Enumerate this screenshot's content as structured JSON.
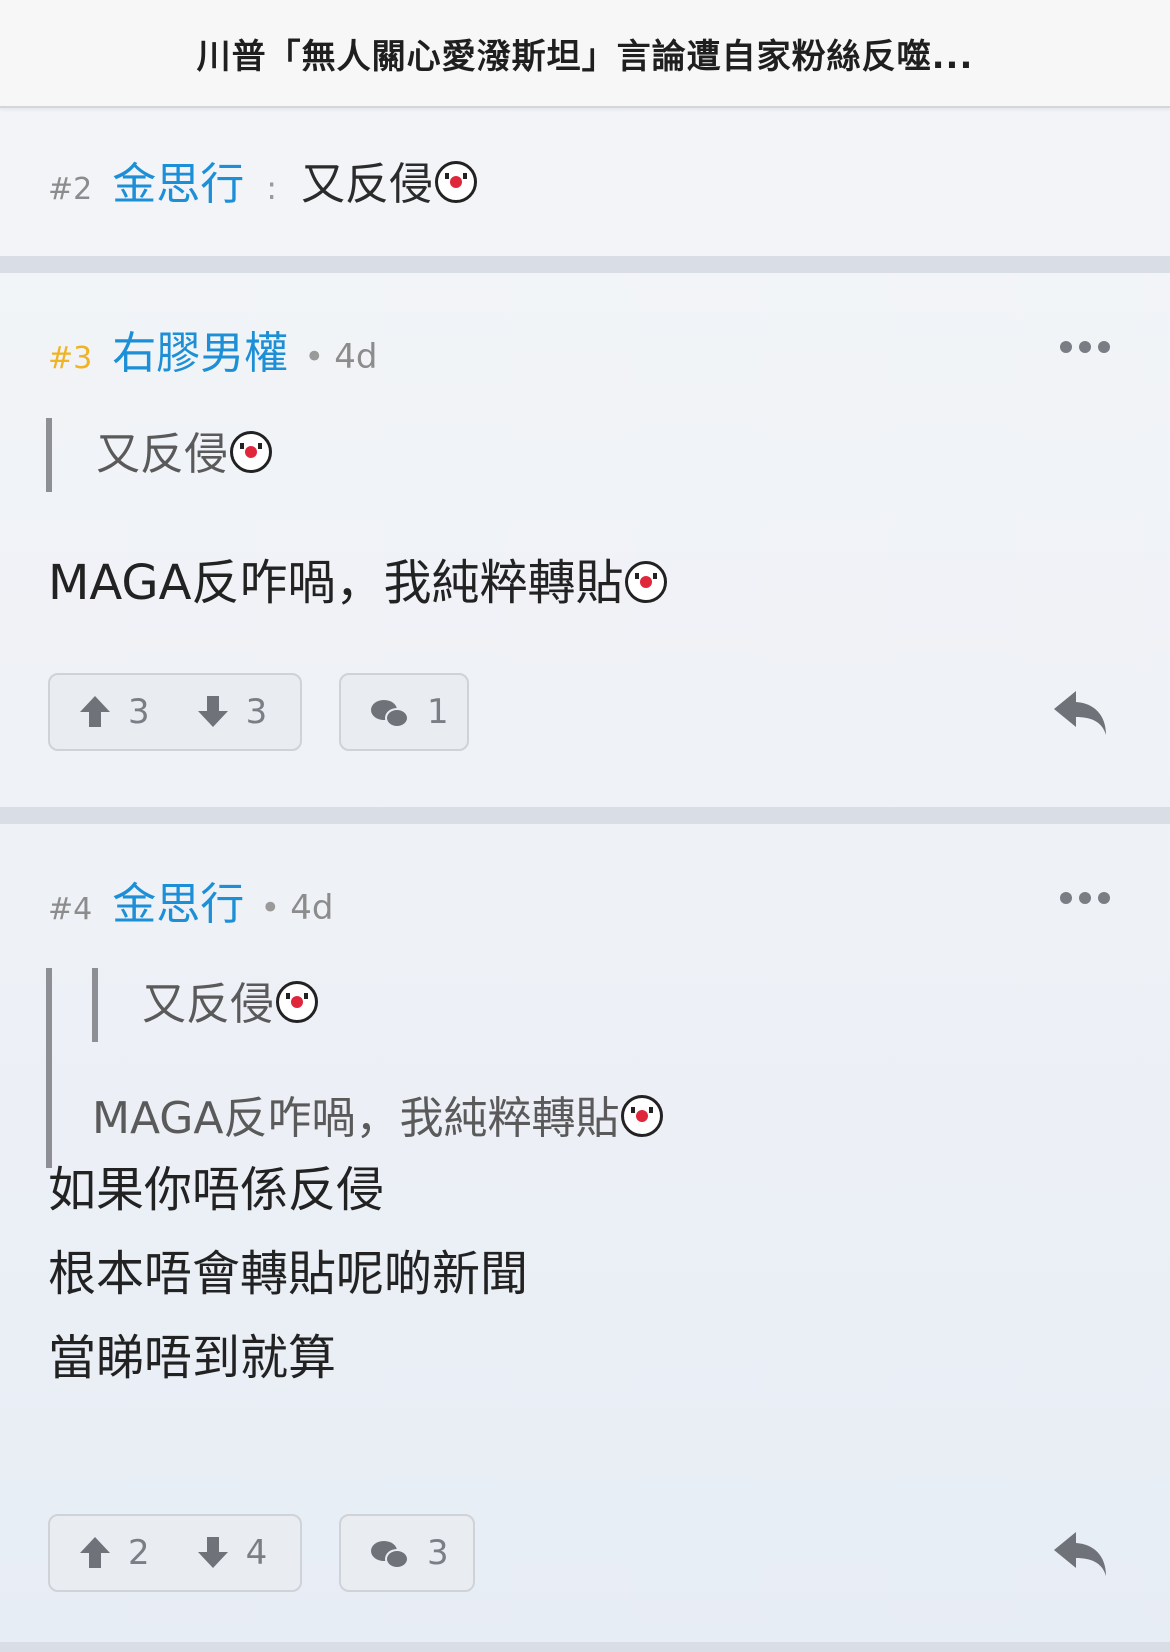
{
  "header": {
    "title": "川普「無人關心愛潑斯坦」言論遭自家粉絲反噬..."
  },
  "posts": [
    {
      "floor": "#2",
      "author": "金思行",
      "colon": ":",
      "inline_text": "又反侵"
    },
    {
      "floor": "#3",
      "author": "右膠男權",
      "dot": "•",
      "age": "4d",
      "quote": "又反侵",
      "content": "MAGA反咋喎，我純粹轉貼",
      "upvotes": "3",
      "downvotes": "3",
      "comments": "1"
    },
    {
      "floor": "#4",
      "author": "金思行",
      "dot": "•",
      "age": "4d",
      "quote_nested": "又反侵",
      "quote": "MAGA反咋喎，我純粹轉貼",
      "content_lines": [
        "如果你唔係反侵",
        "根本唔會轉貼呢啲新聞",
        "當睇唔到就算"
      ],
      "upvotes": "2",
      "downvotes": "4",
      "comments": "3"
    }
  ],
  "icons": {
    "emoji": "clown-face-icon",
    "more": "more-options-icon",
    "upvote": "arrow-up-icon",
    "downvote": "arrow-down-icon",
    "comments": "comment-bubble-icon",
    "reply": "reply-arrow-icon"
  },
  "colors": {
    "author": "#1d8fd6",
    "op_floor": "#f0b323",
    "floor": "#8c8c8c",
    "separator": "#d9dee6"
  }
}
